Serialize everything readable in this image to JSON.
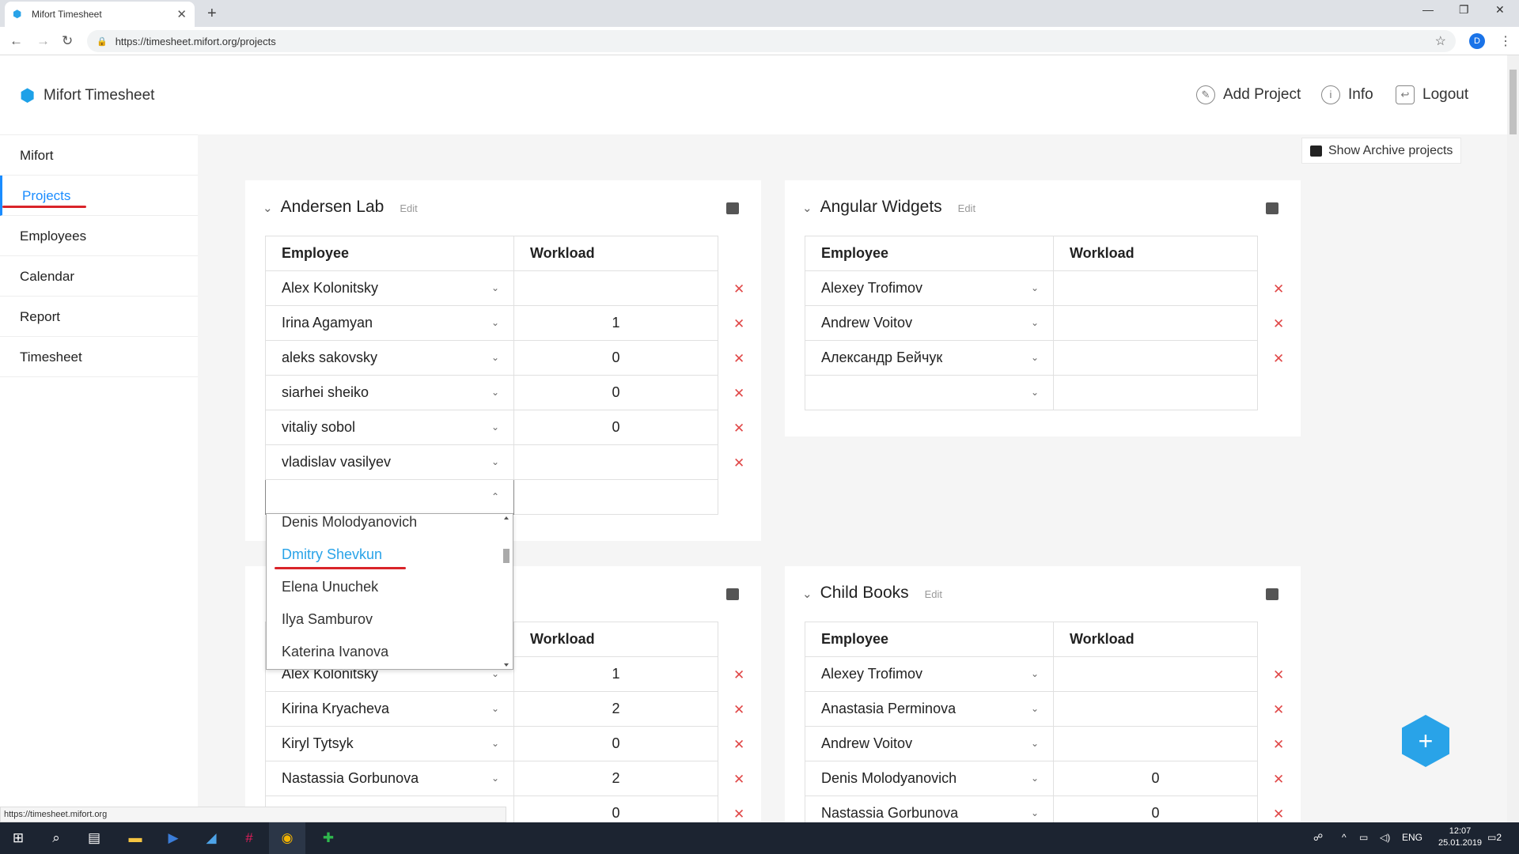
{
  "browser": {
    "tab_title": "Mifort Timesheet",
    "url": "https://timesheet.mifort.org/projects",
    "profile_initial": "D"
  },
  "app": {
    "name": "Mifort Timesheet",
    "header_actions": [
      "Add Project",
      "Info",
      "Logout"
    ]
  },
  "sidebar": {
    "items": [
      "Mifort",
      "Projects",
      "Employees",
      "Calendar",
      "Report",
      "Timesheet"
    ],
    "active": "Projects"
  },
  "show_archive_label": "Show Archive projects",
  "table_headers": {
    "employee": "Employee",
    "workload": "Workload"
  },
  "edit_label": "Edit",
  "projects": [
    {
      "name": "Andersen Lab",
      "rows": [
        {
          "employee": "Alex Kolonitsky",
          "workload": ""
        },
        {
          "employee": "Irina Agamyan",
          "workload": "1"
        },
        {
          "employee": "aleks sakovsky",
          "workload": "0"
        },
        {
          "employee": "siarhei sheiko",
          "workload": "0"
        },
        {
          "employee": "vitaliy sobol",
          "workload": "0"
        },
        {
          "employee": "vladislav vasilyev",
          "workload": ""
        }
      ]
    },
    {
      "name": "Angular Widgets",
      "rows": [
        {
          "employee": "Alexey Trofimov",
          "workload": ""
        },
        {
          "employee": "Andrew Voitov",
          "workload": ""
        },
        {
          "employee": "Александр Бейчук",
          "workload": ""
        }
      ]
    },
    {
      "name": "",
      "rows": [
        {
          "employee": "Alex Kolonitsky",
          "workload": "1"
        },
        {
          "employee": "Kirina Kryacheva",
          "workload": "2"
        },
        {
          "employee": "Kiryl Tytsyk",
          "workload": "0"
        },
        {
          "employee": "Nastassia Gorbunova",
          "workload": "2"
        },
        {
          "employee": "",
          "workload": "0"
        }
      ]
    },
    {
      "name": "Child Books",
      "rows": [
        {
          "employee": "Alexey Trofimov",
          "workload": ""
        },
        {
          "employee": "Anastasia Perminova",
          "workload": ""
        },
        {
          "employee": "Andrew Voitov",
          "workload": ""
        },
        {
          "employee": "Denis Molodyanovich",
          "workload": "0"
        },
        {
          "employee": "Nastassia Gorbunova",
          "workload": "0"
        }
      ]
    }
  ],
  "dropdown": {
    "options": [
      "Denis Molodyanovich",
      "Dmitry Shevkun",
      "Elena Unuchek",
      "Ilya Samburov",
      "Katerina Ivanova"
    ],
    "highlighted": "Dmitry Shevkun"
  },
  "status_url": "https://timesheet.mifort.org",
  "taskbar": {
    "lang": "ENG",
    "time": "12:07",
    "date": "25.01.2019",
    "notifications": "2"
  },
  "colors": {
    "accent": "#29a3e8",
    "annotation": "#d9242a",
    "delete": "#e04848"
  }
}
